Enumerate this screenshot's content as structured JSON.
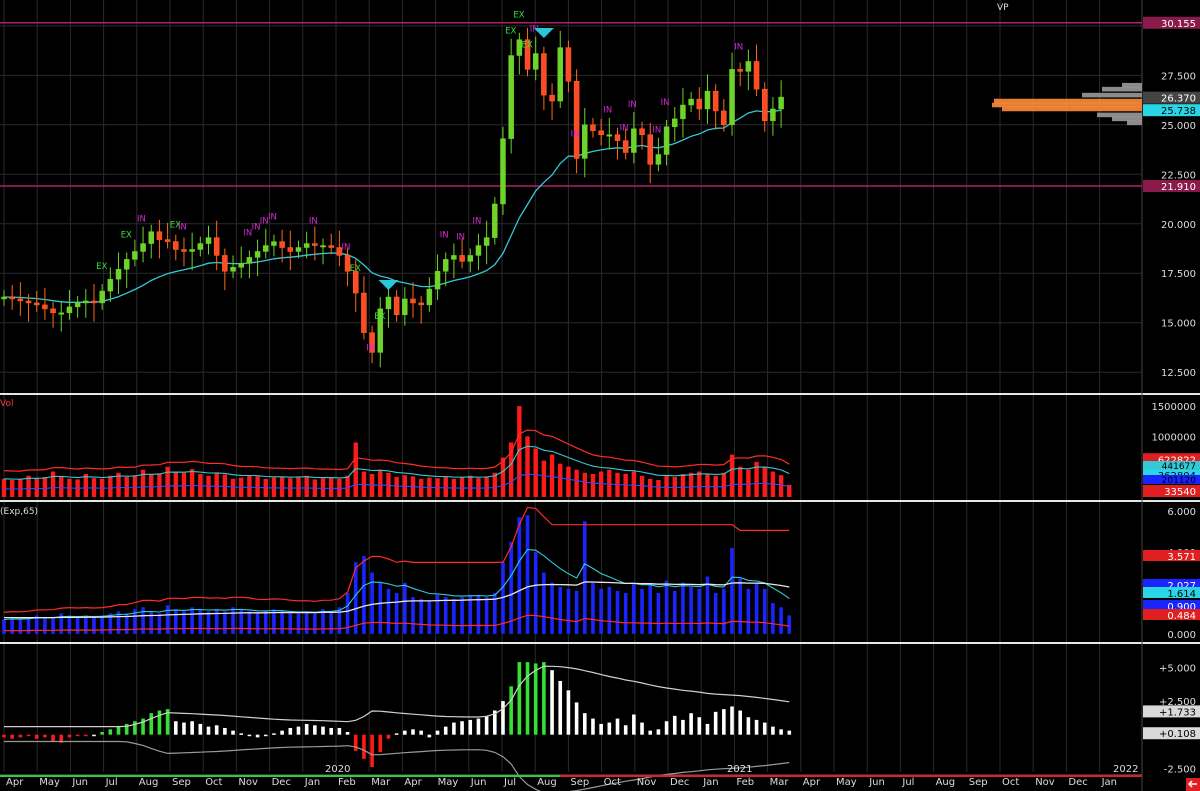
{
  "colors": {
    "background": "#000000",
    "grid": "#2a2a2a",
    "separator": "#e6e6e6",
    "candle_up": "#6ed32a",
    "candle_down": "#ff6a1a",
    "ma_line": "#33c9d6",
    "hline": "#b0206a",
    "label_in": "#d22ad6",
    "label_ex": "#35e03a",
    "marker": "#28c7dc",
    "volume_bar": "#ff1a1a",
    "band_red": "#ff2a2a",
    "blue_bar": "#1a24ff",
    "white_line": "#e8e8e8",
    "hist_green": "#35e035",
    "hist_red": "#ff1a1a",
    "hist_white": "#ffffff",
    "vp_orange": "#ff8c3a",
    "vp_gray": "#9a9a9a"
  },
  "chart_data": [
    {
      "name": "price",
      "type": "candlestick",
      "y_ticks": [
        "30.155",
        "27.500",
        "26.370",
        "25.738",
        "25.000",
        "22.500",
        "21.910",
        "20.000",
        "17.500",
        "15.000",
        "12.500"
      ],
      "ylim": [
        11.5,
        30.8
      ],
      "hlines": [
        30.155,
        21.91
      ],
      "last_close_label": "26.370",
      "ma_label": "25.738",
      "volume_profile_label": "VP",
      "series_close": [
        16.3,
        16.2,
        16.1,
        16.0,
        15.9,
        15.7,
        15.5,
        15.5,
        15.8,
        16.0,
        16.1,
        16.0,
        16.6,
        17.2,
        17.7,
        18.2,
        18.6,
        19.0,
        19.6,
        19.2,
        19.1,
        18.7,
        18.6,
        18.7,
        19.0,
        19.3,
        18.4,
        17.6,
        17.8,
        18.0,
        18.3,
        18.6,
        18.9,
        19.1,
        18.8,
        18.6,
        18.8,
        19.0,
        18.9,
        18.9,
        18.8,
        18.4,
        17.6,
        16.5,
        14.5,
        13.5,
        15.7,
        16.3,
        15.4,
        16.2,
        16.0,
        15.9,
        16.7,
        17.6,
        18.2,
        18.4,
        18.1,
        18.4,
        18.9,
        19.3,
        21.0,
        24.3,
        28.5,
        29.3,
        27.8,
        28.6,
        26.5,
        26.2,
        28.9,
        27.2,
        23.3,
        25.0,
        24.7,
        24.5,
        24.5,
        24.2,
        23.6,
        24.8,
        24.5,
        23.0,
        23.5,
        24.9,
        25.3,
        26.0,
        26.3,
        25.8,
        26.7,
        25.7,
        25.0,
        27.8,
        27.7,
        28.2,
        26.8,
        25.2,
        25.8,
        26.4
      ],
      "up_labels": [
        {
          "i": 12,
          "t": "EX"
        },
        {
          "i": 15,
          "t": "EX"
        },
        {
          "i": 17,
          "t": "IN"
        },
        {
          "i": 21,
          "t": "EX"
        },
        {
          "i": 22,
          "t": "IN"
        },
        {
          "i": 30,
          "t": "IN"
        },
        {
          "i": 31,
          "t": "IN"
        },
        {
          "i": 32,
          "t": "IN"
        },
        {
          "i": 33,
          "t": "IN"
        },
        {
          "i": 38,
          "t": "IN"
        },
        {
          "i": 42,
          "t": "IN"
        },
        {
          "i": 43,
          "t": "EX"
        },
        {
          "i": 54,
          "t": "IN"
        },
        {
          "i": 56,
          "t": "IN"
        },
        {
          "i": 58,
          "t": "IN"
        },
        {
          "i": 62,
          "t": "EX"
        },
        {
          "i": 63,
          "t": "EX"
        },
        {
          "i": 64,
          "t": "EX"
        },
        {
          "i": 65,
          "t": "IN"
        },
        {
          "i": 70,
          "t": "IN"
        },
        {
          "i": 74,
          "t": "IN"
        },
        {
          "i": 76,
          "t": "IN"
        },
        {
          "i": 77,
          "t": "IN"
        },
        {
          "i": 80,
          "t": "IN"
        },
        {
          "i": 81,
          "t": "IN"
        },
        {
          "i": 90,
          "t": "IN"
        },
        {
          "i": 98,
          "t": "IN"
        }
      ],
      "low_labels": [
        {
          "i": 45,
          "t": "IN"
        },
        {
          "i": 46,
          "t": "EX"
        }
      ],
      "markers": [
        {
          "i": 66,
          "type": "down-triangle"
        },
        {
          "i": 47,
          "type": "down-triangle"
        }
      ]
    },
    {
      "name": "volume",
      "type": "bar",
      "panel_title": "Vol",
      "y_ticks": [
        "1500000",
        "1000000"
      ],
      "value_labels": [
        "622822",
        "362804",
        "33540"
      ],
      "partial_labels": [
        "441677",
        "201120"
      ],
      "ylim": [
        0,
        1650000
      ],
      "values": [
        300000,
        280000,
        290000,
        350000,
        310000,
        330000,
        420000,
        340000,
        300000,
        290000,
        380000,
        310000,
        300000,
        350000,
        400000,
        330000,
        360000,
        450000,
        380000,
        390000,
        500000,
        420000,
        400000,
        460000,
        380000,
        350000,
        400000,
        370000,
        300000,
        320000,
        350000,
        340000,
        300000,
        320000,
        330000,
        310000,
        340000,
        350000,
        290000,
        310000,
        320000,
        300000,
        350000,
        900000,
        420000,
        380000,
        450000,
        400000,
        330000,
        360000,
        340000,
        300000,
        320000,
        310000,
        330000,
        300000,
        320000,
        350000,
        310000,
        340000,
        400000,
        650000,
        900000,
        1500000,
        1000000,
        800000,
        600000,
        700000,
        550000,
        500000,
        450000,
        400000,
        380000,
        420000,
        450000,
        400000,
        380000,
        420000,
        350000,
        300000,
        280000,
        350000,
        330000,
        380000,
        400000,
        420000,
        380000,
        350000,
        400000,
        700000,
        500000,
        450000,
        580000,
        500000,
        420000,
        360000,
        200000
      ],
      "band_upper": 622822,
      "ma_line": 362804
    },
    {
      "name": "oscillator",
      "type": "bar",
      "panel_title": "(Exp,65)",
      "y_ticks": [
        "6.000",
        "4.000",
        "0.000"
      ],
      "value_labels": [
        "3.571",
        "2.027",
        "1.614",
        "0.900",
        "0.484"
      ],
      "ylim": [
        -0.3,
        6.3
      ],
      "values": [
        0.7,
        0.8,
        0.7,
        0.8,
        0.9,
        0.8,
        0.8,
        1.0,
        0.9,
        0.8,
        0.9,
        0.8,
        0.9,
        1.0,
        1.1,
        1.0,
        1.2,
        1.3,
        1.1,
        1.0,
        1.4,
        1.2,
        1.1,
        1.3,
        1.2,
        1.1,
        1.2,
        1.1,
        1.3,
        1.2,
        1.1,
        1.0,
        1.1,
        1.2,
        1.1,
        1.0,
        1.0,
        1.1,
        1.0,
        1.2,
        1.1,
        1.3,
        2.0,
        3.5,
        3.8,
        3.0,
        2.5,
        2.2,
        2.0,
        2.5,
        1.8,
        1.7,
        1.6,
        1.9,
        1.8,
        1.7,
        1.8,
        1.9,
        1.9,
        1.8,
        2.0,
        3.5,
        4.5,
        5.7,
        5.8,
        4.0,
        3.0,
        2.5,
        2.3,
        2.2,
        2.1,
        5.5,
        2.5,
        2.2,
        2.3,
        2.1,
        2.0,
        2.5,
        2.2,
        2.4,
        2.0,
        2.6,
        2.1,
        2.5,
        2.3,
        2.2,
        2.8,
        2.0,
        2.2,
        4.2,
        2.7,
        2.2,
        2.5,
        2.2,
        1.5,
        1.3,
        0.9
      ]
    },
    {
      "name": "histogram",
      "type": "bar",
      "y_ticks": [
        "+5.000",
        "+2.500",
        "+1.733",
        "+0.108",
        "-2.500"
      ],
      "ylim": [
        -3.0,
        6.6
      ],
      "values": [
        -0.2,
        -0.3,
        -0.2,
        -0.1,
        -0.3,
        -0.2,
        -0.5,
        -0.6,
        -0.2,
        -0.1,
        -0.1,
        0.0,
        0.2,
        0.4,
        0.6,
        0.8,
        1.0,
        1.2,
        1.6,
        1.8,
        1.9,
        1.0,
        0.9,
        1.0,
        0.8,
        0.6,
        0.7,
        0.5,
        0.3,
        0.1,
        -0.1,
        -0.2,
        -0.1,
        0.1,
        0.3,
        0.5,
        0.6,
        0.8,
        0.7,
        0.6,
        0.5,
        0.5,
        0.2,
        -1.2,
        -1.8,
        -2.4,
        -1.3,
        -0.3,
        0.1,
        0.3,
        0.4,
        0.3,
        -0.2,
        0.3,
        0.6,
        0.9,
        1.0,
        1.1,
        1.2,
        1.4,
        1.8,
        2.5,
        3.6,
        5.4,
        5.4,
        5.3,
        5.4,
        4.8,
        4.0,
        3.3,
        2.4,
        1.6,
        1.2,
        0.8,
        0.9,
        1.2,
        0.7,
        1.5,
        0.9,
        0.3,
        0.4,
        1.0,
        1.4,
        1.1,
        1.6,
        1.3,
        0.8,
        1.7,
        1.9,
        2.1,
        1.8,
        1.3,
        1.1,
        0.9,
        0.6,
        0.4,
        0.3
      ],
      "green_ranges": [
        [
          12,
          20
        ],
        [
          62,
          66
        ]
      ],
      "red_ranges": [
        [
          0,
          11
        ],
        [
          43,
          47
        ]
      ]
    }
  ],
  "x_axis": {
    "labels": [
      "Apr",
      "May",
      "Jun",
      "Jul",
      "Aug",
      "Sep",
      "Oct",
      "Nov",
      "Dec",
      "Jan",
      "Feb",
      "Mar",
      "Apr",
      "May",
      "Jun",
      "Jul",
      "Aug",
      "Sep",
      "Oct",
      "Nov",
      "Dec",
      "Jan",
      "Feb",
      "Mar",
      "Apr",
      "May",
      "Jun",
      "Jul",
      "Aug",
      "Sep",
      "Oct",
      "Nov",
      "Dec",
      "Jan"
    ],
    "years": [
      "2020",
      "2021",
      "2022"
    ]
  },
  "corner_icon": "red-arrow-icon"
}
